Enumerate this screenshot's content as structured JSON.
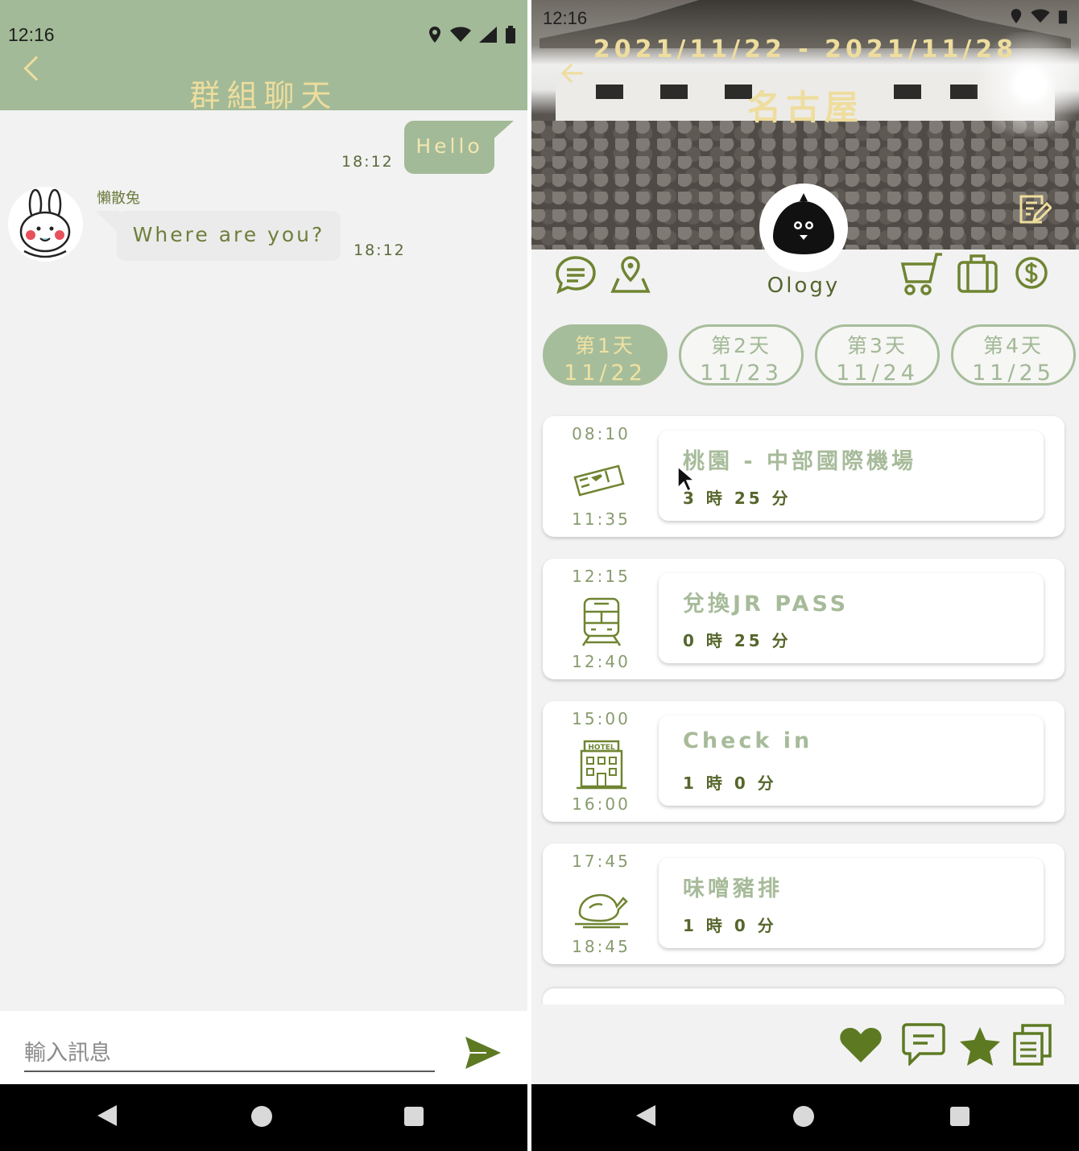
{
  "left_phone": {
    "status_time": "12:16",
    "header_title": "群組聊天",
    "messages": [
      {
        "direction": "outgoing",
        "text": "Hello",
        "time": "18:12"
      },
      {
        "direction": "incoming",
        "sender": "懶散兔",
        "text": "Where are you?",
        "time": "18:12"
      }
    ],
    "input_placeholder": "輸入訊息",
    "icons": {
      "back": "back-chevron-icon",
      "send": "send-icon",
      "avatar": "bunny-avatar"
    }
  },
  "right_phone": {
    "status_time": "12:16",
    "date_range": "2021/11/22 - 2021/11/28",
    "city": "名古屋",
    "owner": "Ology",
    "toolbar": [
      "chat-icon",
      "map-pin-icon",
      "cart-icon",
      "luggage-icon",
      "dollar-icon"
    ],
    "days": [
      {
        "label": "第1天",
        "date": "11/22",
        "active": true
      },
      {
        "label": "第2天",
        "date": "11/23",
        "active": false
      },
      {
        "label": "第3天",
        "date": "11/24",
        "active": false
      },
      {
        "label": "第4天",
        "date": "11/25",
        "active": false
      }
    ],
    "schedule": [
      {
        "start": "08:10",
        "end": "11:35",
        "icon": "flight-ticket-icon",
        "title": "桃園 - 中部國際機場",
        "duration": "3 時 25 分"
      },
      {
        "start": "12:15",
        "end": "12:40",
        "icon": "train-icon",
        "title": "兌換JR PASS",
        "duration": "0 時 25 分"
      },
      {
        "start": "15:00",
        "end": "16:00",
        "icon": "hotel-icon",
        "title": "Check in",
        "duration": "1 時 0 分"
      },
      {
        "start": "17:45",
        "end": "18:45",
        "icon": "roast-food-icon",
        "title": "味噌豬排",
        "duration": "1 時 0 分"
      }
    ],
    "hotel_sign": "HOTEL",
    "bottom_actions": [
      "heart-icon",
      "comment-icon",
      "star-icon",
      "copy-icon"
    ],
    "colors": {
      "accent_green": "#a2ba97",
      "dark_olive": "#56662c",
      "gold": "#eedd9d"
    }
  }
}
